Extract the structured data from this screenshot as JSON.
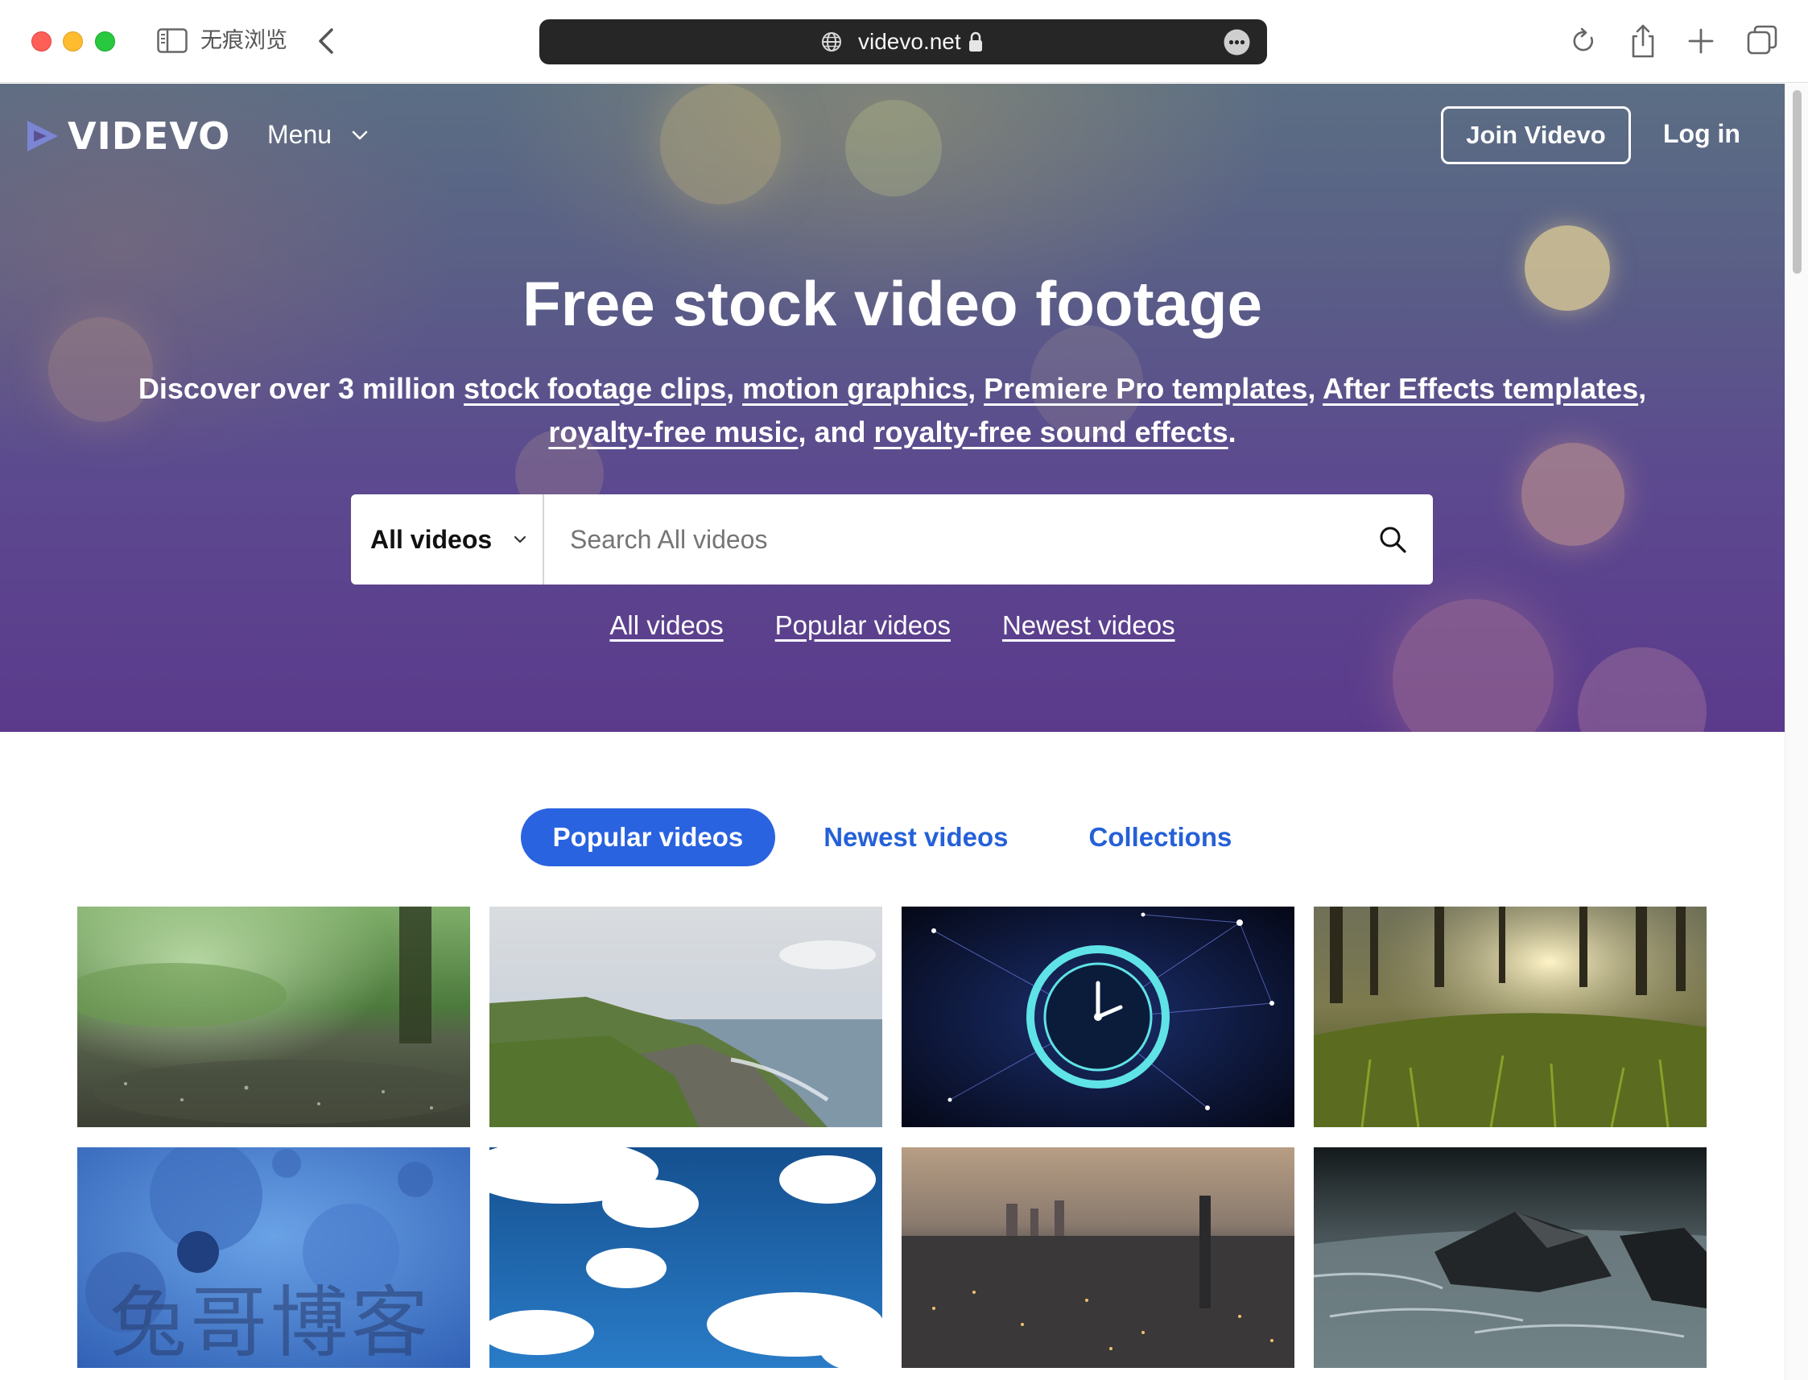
{
  "browser": {
    "private_label": "无痕浏览",
    "url": "videvo.net",
    "icons": [
      "sidebar-icon",
      "back-icon",
      "globe-icon",
      "lock-icon",
      "more-icon",
      "reload-icon",
      "share-icon",
      "new-tab-icon",
      "tabs-overview-icon"
    ]
  },
  "nav": {
    "logo": "VIDEVO",
    "menu_label": "Menu",
    "join_label": "Join Videvo",
    "login_label": "Log in"
  },
  "hero": {
    "title": "Free stock video footage",
    "sub_prefix": "Discover over 3 million ",
    "links": [
      "stock footage clips",
      "motion graphics",
      "Premiere Pro templates",
      "After Effects templates",
      "royalty-free music",
      "royalty-free sound effects"
    ],
    "sub_and": ", and ",
    "sub_end": "."
  },
  "search": {
    "type_label": "All videos",
    "placeholder": "Search All videos"
  },
  "quick_links": [
    "All videos",
    "Popular videos",
    "Newest videos"
  ],
  "tabs": [
    {
      "label": "Popular videos",
      "active": true
    },
    {
      "label": "Newest videos",
      "active": false
    },
    {
      "label": "Collections",
      "active": false
    }
  ],
  "thumbnails": [
    {
      "subject": "rain-on-forest-ground"
    },
    {
      "subject": "rocky-coastline"
    },
    {
      "subject": "glowing-clock-network"
    },
    {
      "subject": "sunlit-forest-grass"
    },
    {
      "subject": "blue-cells-microscopic"
    },
    {
      "subject": "clouds-blue-sky"
    },
    {
      "subject": "city-skyline-dusk"
    },
    {
      "subject": "rocks-in-river"
    }
  ],
  "watermark": "兔哥博客",
  "colors": {
    "accent": "#2a63e0",
    "hero_top": "#5b6e84",
    "hero_bottom": "#5b3a8c",
    "url_bar": "#262626"
  }
}
